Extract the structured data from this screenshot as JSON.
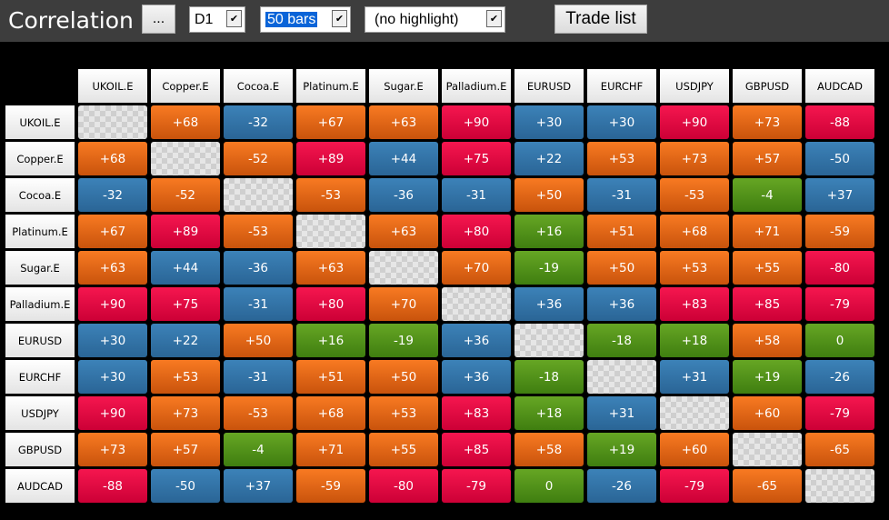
{
  "header": {
    "title": "Correlation",
    "menu_button": "...",
    "timeframe": "D1",
    "bars": "50 bars",
    "highlight": "(no highlight)",
    "trade_list": "Trade list"
  },
  "colors": {
    "red": "#e00a44",
    "orange": "#e06818",
    "blue": "#3272a6",
    "green": "#52921a"
  },
  "symbols": [
    "UKOIL.E",
    "Copper.E",
    "Cocoa.E",
    "Platinum.E",
    "Sugar.E",
    "Palladium.E",
    "EURUSD",
    "EURCHF",
    "USDJPY",
    "GBPUSD",
    "AUDCAD"
  ],
  "matrix": [
    [
      null,
      "+68",
      "-32",
      "+67",
      "+63",
      "+90",
      "+30",
      "+30",
      "+90",
      "+73",
      "-88"
    ],
    [
      "+68",
      null,
      "-52",
      "+89",
      "+44",
      "+75",
      "+22",
      "+53",
      "+73",
      "+57",
      "-50"
    ],
    [
      "-32",
      "-52",
      null,
      "-53",
      "-36",
      "-31",
      "+50",
      "-31",
      "-53",
      "-4",
      "+37"
    ],
    [
      "+67",
      "+89",
      "-53",
      null,
      "+63",
      "+80",
      "+16",
      "+51",
      "+68",
      "+71",
      "-59"
    ],
    [
      "+63",
      "+44",
      "-36",
      "+63",
      null,
      "+70",
      "-19",
      "+50",
      "+53",
      "+55",
      "-80"
    ],
    [
      "+90",
      "+75",
      "-31",
      "+80",
      "+70",
      null,
      "+36",
      "+36",
      "+83",
      "+85",
      "-79"
    ],
    [
      "+30",
      "+22",
      "+50",
      "+16",
      "-19",
      "+36",
      null,
      "-18",
      "+18",
      "+58",
      "0"
    ],
    [
      "+30",
      "+53",
      "-31",
      "+51",
      "+50",
      "+36",
      "-18",
      null,
      "+31",
      "+19",
      "-26"
    ],
    [
      "+90",
      "+73",
      "-53",
      "+68",
      "+53",
      "+83",
      "+18",
      "+31",
      null,
      "+60",
      "-79"
    ],
    [
      "+73",
      "+57",
      "-4",
      "+71",
      "+55",
      "+85",
      "+58",
      "+19",
      "+60",
      null,
      "-65"
    ],
    [
      "-88",
      "-50",
      "+37",
      "-59",
      "-80",
      "-79",
      "0",
      "-26",
      "-79",
      "-65",
      null
    ]
  ]
}
